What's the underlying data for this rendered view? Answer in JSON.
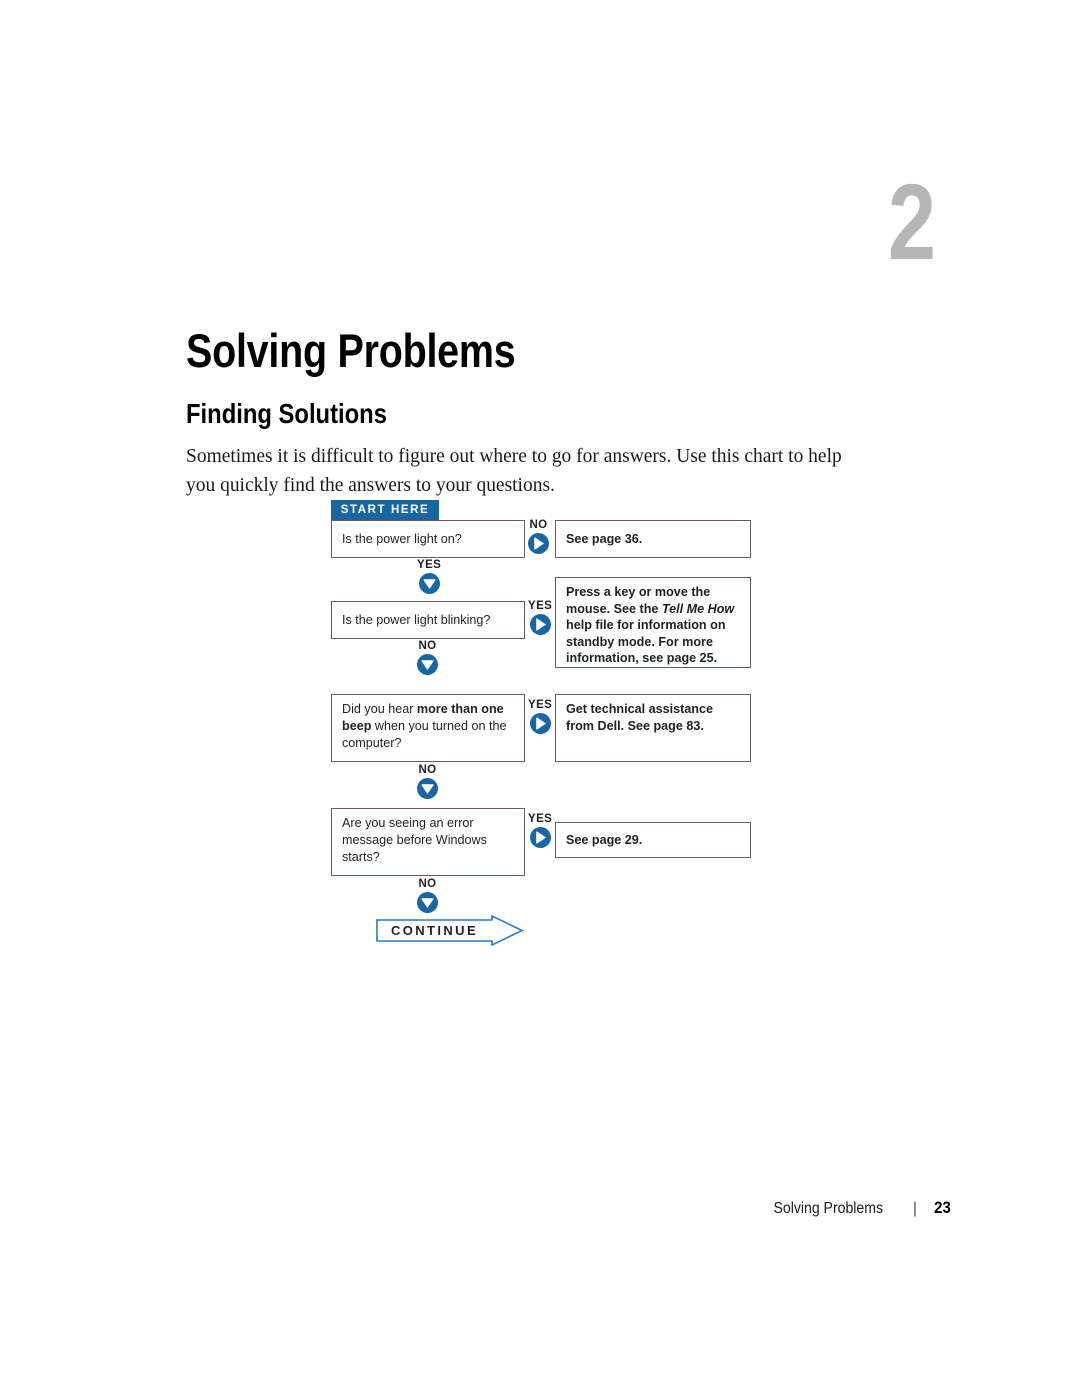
{
  "chapter": {
    "number": "2"
  },
  "headings": {
    "page_title": "Solving Problems",
    "section_title": "Finding Solutions"
  },
  "intro": {
    "paragraph": "Sometimes it is difficult to figure out where to go for answers. Use this chart to help you quickly find the answers to your questions."
  },
  "flowchart": {
    "start_label": "START HERE",
    "continue_label": "CONTINUE",
    "accent_color": "#1966a3",
    "box_border_color": "#6b5c57",
    "steps": [
      {
        "question": "Is the power light on?",
        "side_label": "NO",
        "answer_plain": "See page 36.",
        "down_label": "YES"
      },
      {
        "question": "Is the power light blinking?",
        "side_label": "YES",
        "answer_plain": "Press a key or move the mouse. See the Tell Me How help file for information on standby mode. For more information, see page 25.",
        "answer_italic_part": "Tell Me How",
        "down_label": "NO"
      },
      {
        "question_plain": "Did you hear more than one beep when you turned on the computer?",
        "question_bold_parts": [
          "more than one",
          "beep"
        ],
        "side_label": "YES",
        "answer_plain": "Get technical assistance from Dell. See page 83.",
        "down_label": "NO"
      },
      {
        "question": "Are you seeing an error message before Windows starts?",
        "side_label": "YES",
        "answer_plain": "See page 29.",
        "down_label": "NO"
      }
    ]
  },
  "footer": {
    "title": "Solving Problems",
    "separator": "|",
    "page_number": "23"
  }
}
